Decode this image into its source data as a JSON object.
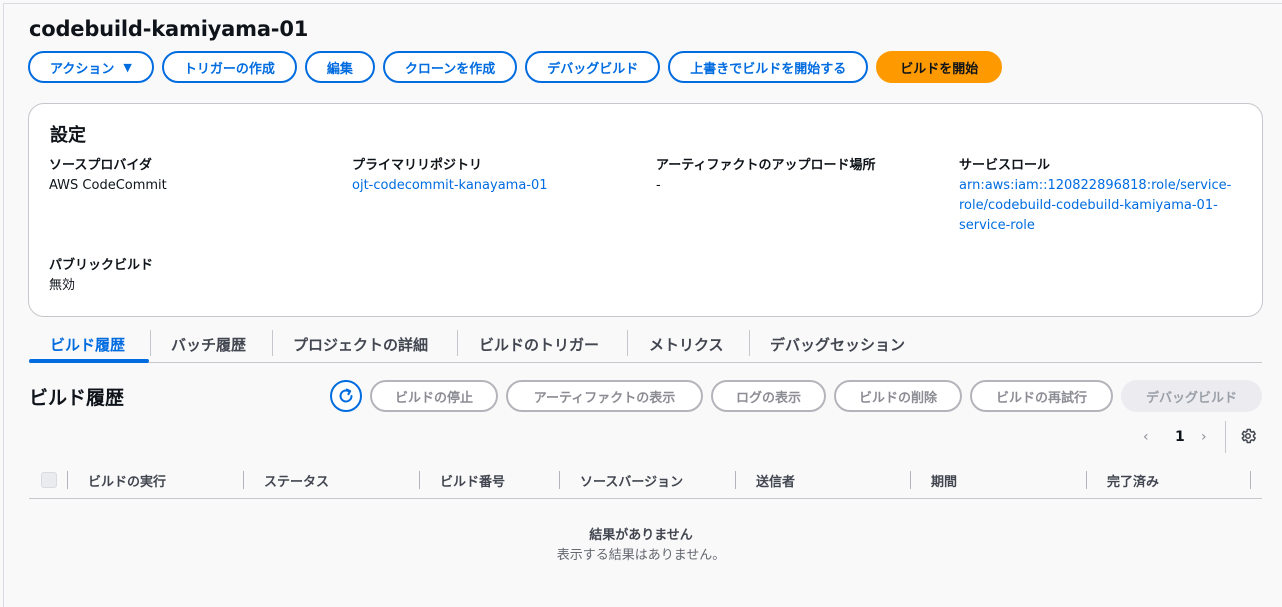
{
  "page": {
    "title": "codebuild-kamiyama-01"
  },
  "toolbar": {
    "actions_label": "アクション",
    "create_trigger_label": "トリガーの作成",
    "edit_label": "編集",
    "clone_label": "クローンを作成",
    "debug_build_label": "デバッグビルド",
    "override_start_label": "上書きでビルドを開始する",
    "start_build_label": "ビルドを開始"
  },
  "settings": {
    "title": "設定",
    "source_provider": {
      "label": "ソースプロバイダ",
      "value": "AWS CodeCommit"
    },
    "primary_repo": {
      "label": "プライマリリポジトリ",
      "value": "ojt-codecommit-kanayama-01"
    },
    "artifact_location": {
      "label": "アーティファクトのアップロード場所",
      "value": "-"
    },
    "service_role": {
      "label": "サービスロール",
      "line1": "arn:aws:iam::120822896818:role/service-",
      "line2": "role/codebuild-codebuild-kamiyama-01-",
      "line3": "service-role"
    },
    "public_build": {
      "label": "パブリックビルド",
      "value": "無効"
    }
  },
  "tabs": [
    {
      "label": "ビルド履歴",
      "active": true
    },
    {
      "label": "バッチ履歴",
      "active": false
    },
    {
      "label": "プロジェクトの詳細",
      "active": false
    },
    {
      "label": "ビルドのトリガー",
      "active": false
    },
    {
      "label": "メトリクス",
      "active": false
    },
    {
      "label": "デバッグセッション",
      "active": false
    }
  ],
  "history": {
    "title": "ビルド履歴",
    "buttons": {
      "stop": "ビルドの停止",
      "view_artifacts": "アーティファクトの表示",
      "view_logs": "ログの表示",
      "delete": "ビルドの削除",
      "retry": "ビルドの再試行",
      "debug": "デバッグビルド"
    },
    "pagination": {
      "prev": "‹",
      "page": "1",
      "next": "›"
    },
    "columns": [
      "ビルドの実行",
      "ステータス",
      "ビルド番号",
      "ソースバージョン",
      "送信者",
      "期間",
      "完了済み"
    ],
    "empty_title": "結果がありません",
    "empty_message": "表示する結果はありません。"
  },
  "colors": {
    "accent": "#006ce0",
    "primary": "#ff9900",
    "disabled": "#8c8c94"
  },
  "icons": {
    "refresh": "refresh-icon",
    "settings": "gear-icon",
    "caret": "caret-down-icon"
  }
}
